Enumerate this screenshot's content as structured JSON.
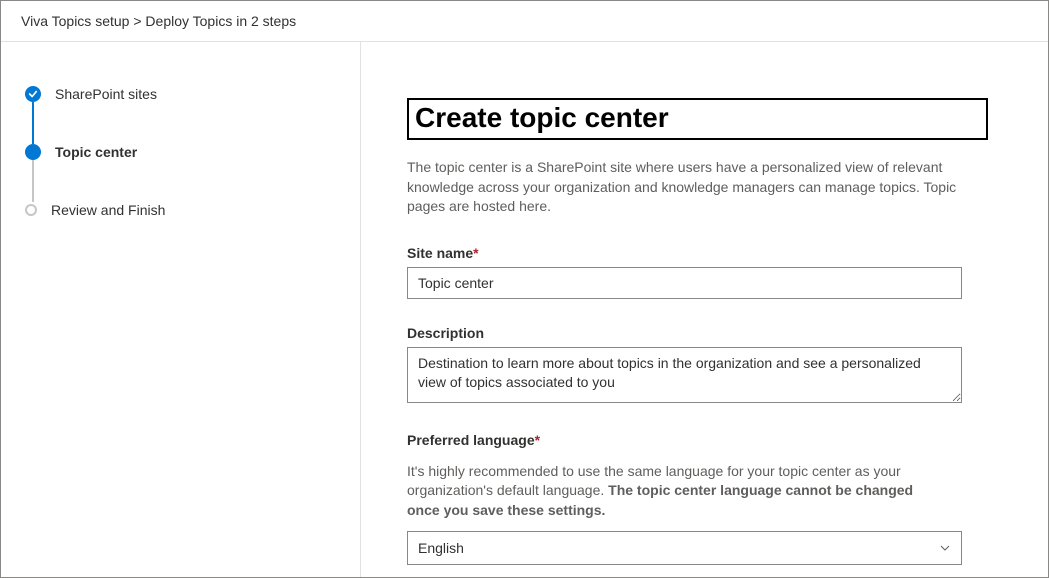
{
  "breadcrumb": {
    "parent": "Viva Topics setup",
    "sep": ">",
    "current": "Deploy Topics in 2 steps"
  },
  "steps": {
    "s1": "SharePoint sites",
    "s2": "Topic center",
    "s3": "Review and Finish"
  },
  "page": {
    "title": "Create topic center",
    "intro": "The topic center is a SharePoint site where users have a personalized view of relevant knowledge across your organization and knowledge managers can manage topics. Topic pages are hosted here."
  },
  "siteName": {
    "label": "Site name",
    "value": "Topic center"
  },
  "description": {
    "label": "Description",
    "value": "Destination to learn more about topics in the organization and see a personalized view of topics associated to you"
  },
  "language": {
    "label": "Preferred language",
    "helper_prefix": "It's highly recommended to use the same language for your topic center as your organization's default language. ",
    "helper_bold": "The topic center language cannot be changed once you save these settings.",
    "value": "English"
  }
}
